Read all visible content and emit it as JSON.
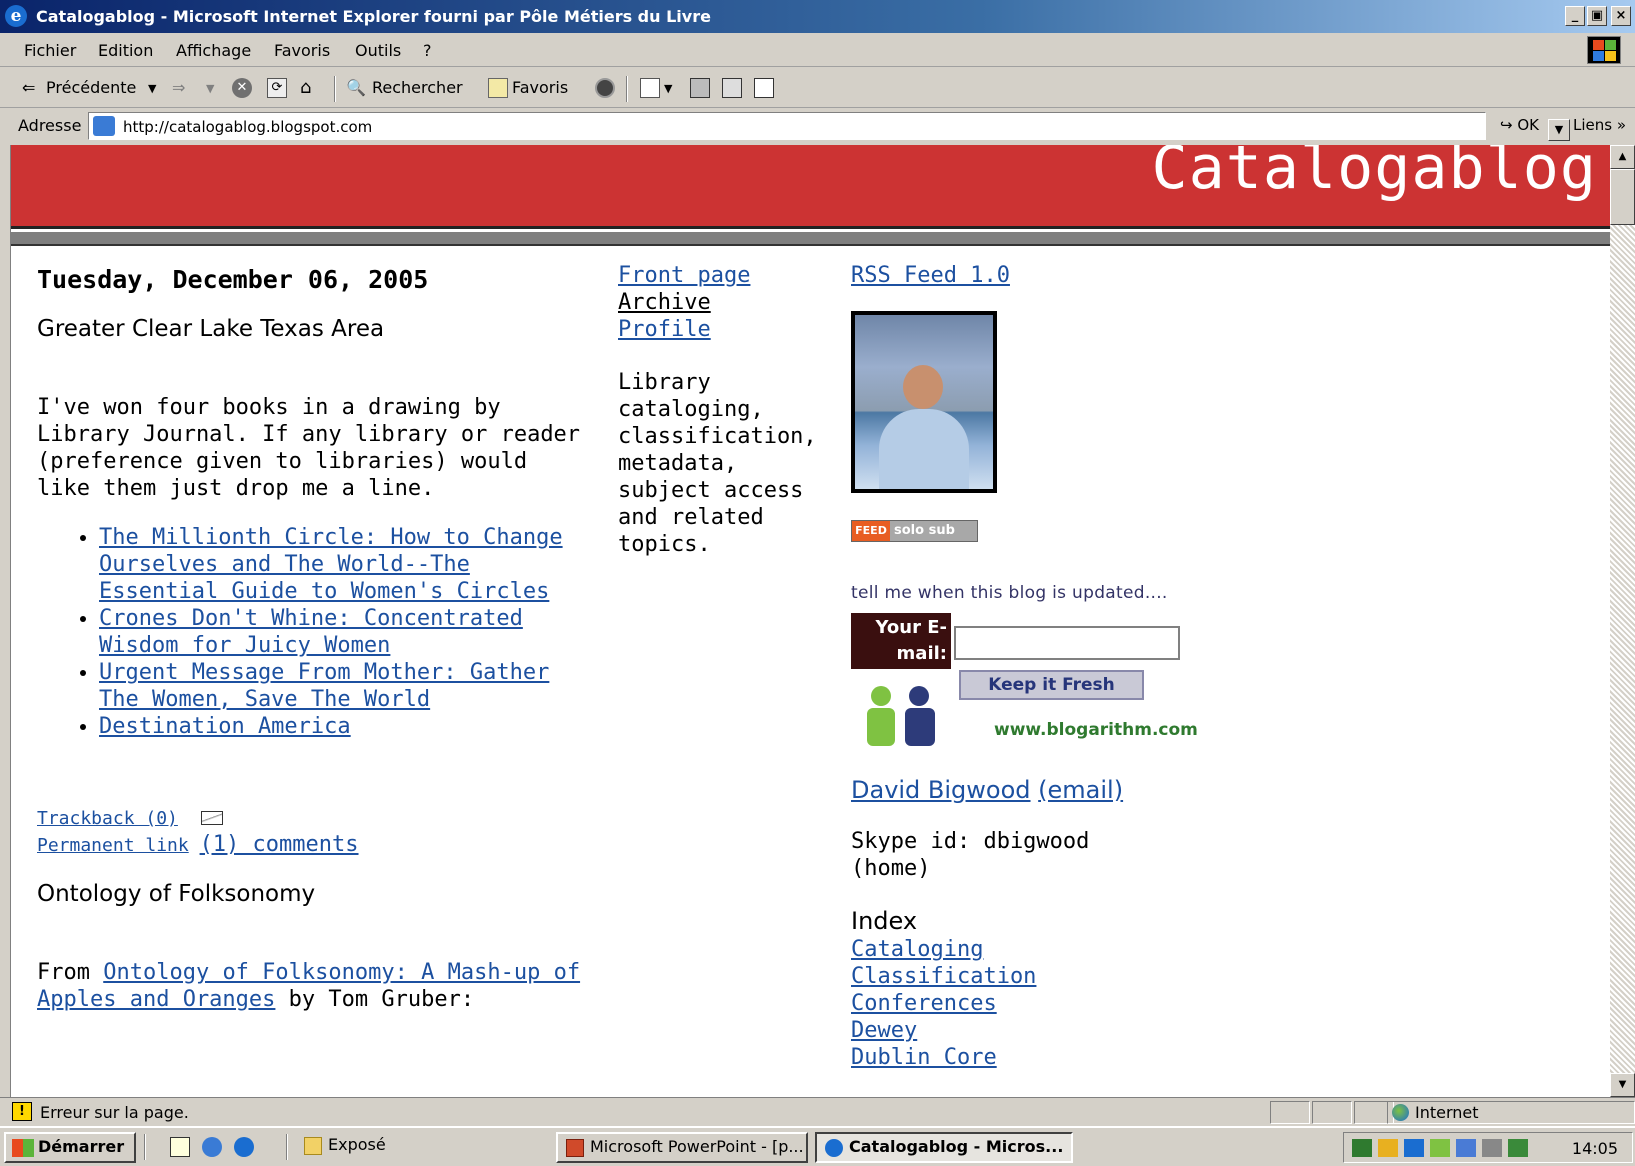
{
  "window": {
    "title": "Catalogablog - Microsoft Internet Explorer fourni par Pôle Métiers du Livre",
    "min": "_",
    "max": "▣",
    "close": "×"
  },
  "menu": [
    "Fichier",
    "Edition",
    "Affichage",
    "Favoris",
    "Outils",
    "?"
  ],
  "toolbar": {
    "back": "Précédente",
    "search": "Rechercher",
    "favorites": "Favoris"
  },
  "address": {
    "label": "Adresse",
    "url": "http://catalogablog.blogspot.com",
    "go": "OK",
    "links": "Liens"
  },
  "blog": {
    "name": "Catalogablog",
    "date": "Tuesday, December 06, 2005",
    "post1": {
      "title": "Greater Clear Lake Texas Area",
      "body": "I've won four books in a drawing by Library Journal. If any library or reader (preference given to libraries) would like them just drop me a line.",
      "books": [
        "The Millionth Circle: How to Change Ourselves and The World--The Essential Guide to Women's Circles",
        "Crones Don't Whine: Concentrated Wisdom for Juicy Women",
        "Urgent Message From Mother: Gather The Women, Save The World",
        "Destination America"
      ],
      "trackback": "Trackback (0)",
      "permalink": "Permanent link",
      "comments": "(1) comments"
    },
    "post2": {
      "title": "Ontology of Folksonomy",
      "from": "From",
      "link": "Ontology of Folksonomy: A Mash-up of Apples and Oranges",
      "by": "by Tom Gruber:"
    },
    "nav": {
      "front": "Front page",
      "archive": "Archive",
      "profile": "Profile",
      "description": "Library cataloging, classification, metadata, subject access and related topics."
    },
    "sidebar": {
      "rss": "RSS Feed 1.0",
      "feed_badge_left": "FEED",
      "feed_badge_right": "solo sub",
      "tell_me": "tell me when this blog is updated....",
      "email_label": "Your E-mail:",
      "email_value": "",
      "keep_button": "Keep it Fresh",
      "blogarithm": "www.blogarithm.com",
      "author": "David Bigwood",
      "author_email": "(email)",
      "skype": "Skype id: dbigwood (home)",
      "index_title": "Index",
      "index": [
        "Cataloging",
        "Classification",
        "Conferences",
        "Dewey",
        "Dublin Core"
      ]
    }
  },
  "status": {
    "message": "Erreur sur la page.",
    "zone": "Internet"
  },
  "taskbar": {
    "start": "Démarrer",
    "tasks": [
      "Exposé",
      "Microsoft PowerPoint - [p...",
      "Catalogablog - Micros..."
    ],
    "clock": "14:05"
  }
}
